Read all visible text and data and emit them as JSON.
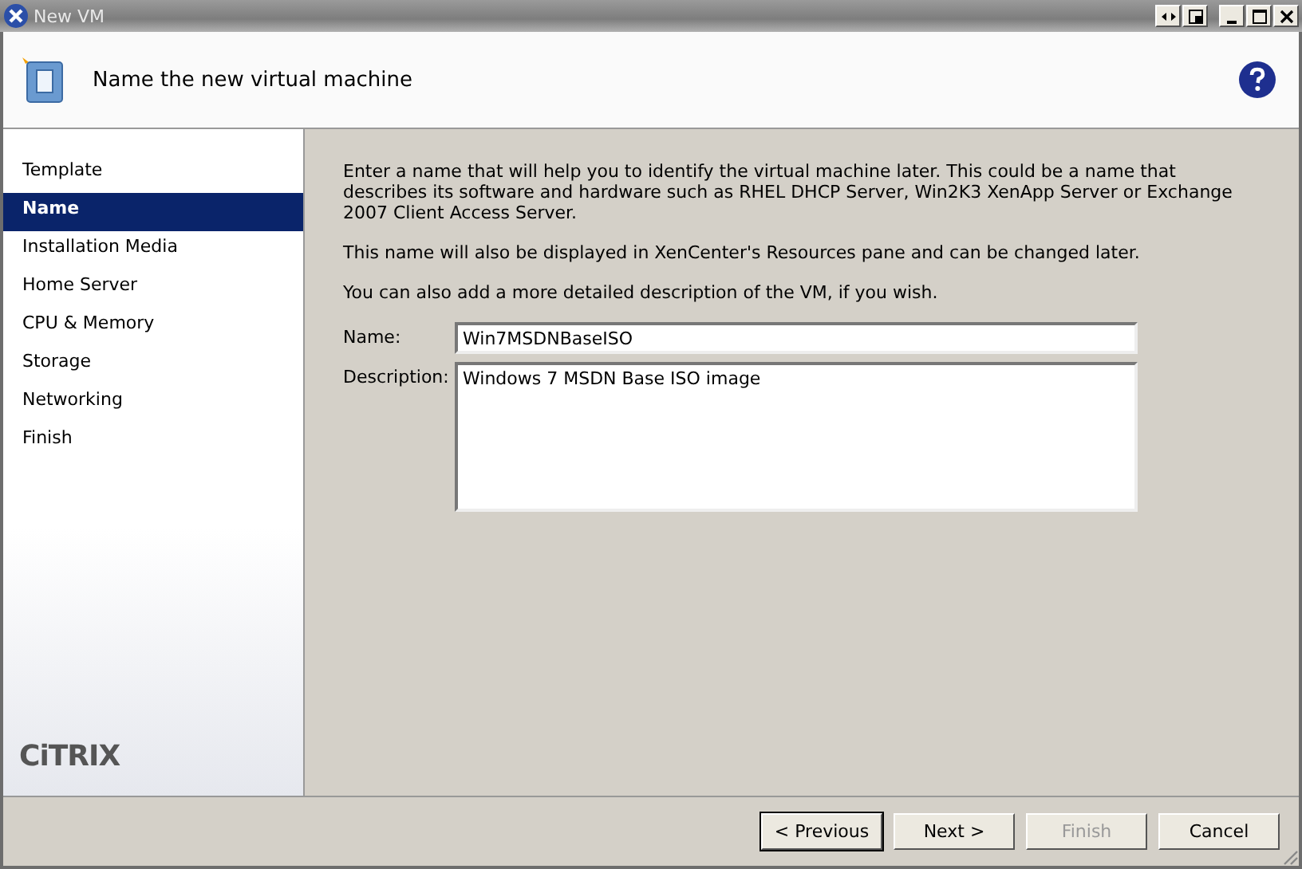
{
  "window": {
    "title": "New VM"
  },
  "header": {
    "title": "Name the new virtual machine"
  },
  "steps": [
    {
      "label": "Template",
      "selected": false
    },
    {
      "label": "Name",
      "selected": true
    },
    {
      "label": "Installation Media",
      "selected": false
    },
    {
      "label": "Home Server",
      "selected": false
    },
    {
      "label": "CPU & Memory",
      "selected": false
    },
    {
      "label": "Storage",
      "selected": false
    },
    {
      "label": "Networking",
      "selected": false
    },
    {
      "label": "Finish",
      "selected": false
    }
  ],
  "logo": "CiTRIX",
  "paragraphs": [
    "Enter a name that will help you to identify the virtual machine later. This could be a name that describes its software and hardware such as RHEL DHCP Server, Win2K3 XenApp Server or Exchange 2007 Client Access Server.",
    "This name will also be displayed in XenCenter's Resources pane and can be changed later.",
    "You can also add a more detailed description of the VM, if you wish."
  ],
  "form": {
    "name_label": "Name:",
    "name_value": "Win7MSDNBaseISO",
    "description_label": "Description:",
    "description_value": "Windows 7 MSDN Base ISO image"
  },
  "buttons": [
    {
      "label": "< Previous",
      "disabled": false,
      "default": true
    },
    {
      "label": "Next >",
      "disabled": false,
      "default": false
    },
    {
      "label": "Finish",
      "disabled": true,
      "default": false
    },
    {
      "label": "Cancel",
      "disabled": false,
      "default": false
    }
  ]
}
